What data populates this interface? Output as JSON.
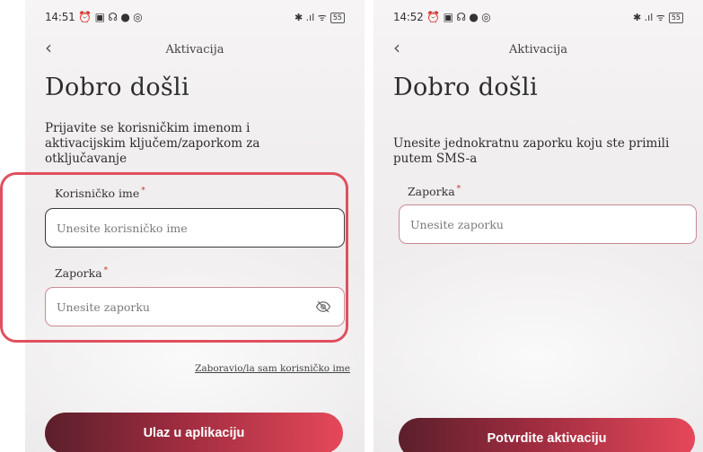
{
  "left_screen": {
    "status": {
      "time": "14:51",
      "left_icons": "⏰ ▣ ☊ ● ◎",
      "right_icons": "✱ .ıl ᯤ",
      "battery": "55"
    },
    "header_title": "Aktivacija",
    "page_title": "Dobro došli",
    "intro_text": "Prijavite se korisničkim imenom i aktivacijskim ključem/zaporkom za otključavanje",
    "username_field": {
      "label": "Korisničko ime",
      "required_mark": "*",
      "placeholder": "Unesite korisničko ime"
    },
    "password_field": {
      "label": "Zaporka",
      "required_mark": "*",
      "placeholder": "Unesite zaporku"
    },
    "forgot_username_link": "Zaboravio/la sam korisničko ime",
    "primary_button": "Ulaz u aplikaciju"
  },
  "right_screen": {
    "status": {
      "time": "14:52",
      "left_icons": "⏰ ▣ ☊ ● ◎",
      "right_icons": "✱ .ıl ᯤ",
      "battery": "55"
    },
    "header_title": "Aktivacija",
    "page_title": "Dobro došli",
    "intro_text": "Unesite jednokratnu zaporku koju ste primili putem SMS-a",
    "otp_field": {
      "label": "Zaporka",
      "required_mark": "*",
      "placeholder": "Unesite zaporku"
    },
    "primary_button": "Potvrdite aktivaciju"
  },
  "colors": {
    "accent": "#e0505e",
    "button_start": "#5b1f2b",
    "button_end": "#e5485a"
  },
  "icons": {
    "back": "chevron-left-icon",
    "password_visibility": "eye-off-icon"
  }
}
